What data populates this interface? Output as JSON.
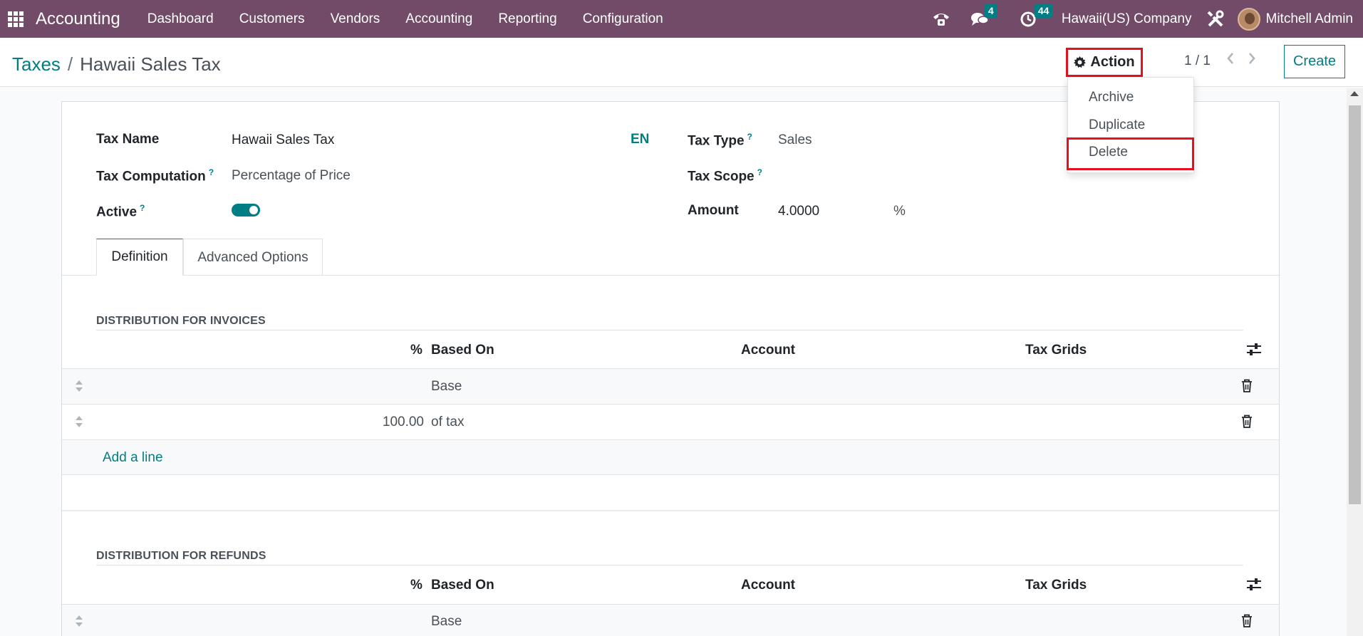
{
  "navbar": {
    "brand": "Accounting",
    "menu": [
      "Dashboard",
      "Customers",
      "Vendors",
      "Accounting",
      "Reporting",
      "Configuration"
    ],
    "messages_count": "4",
    "activities_count": "44",
    "company": "Hawaii(US) Company",
    "user": "Mitchell Admin"
  },
  "breadcrumb": {
    "parent": "Taxes",
    "separator": "/",
    "current": "Hawaii Sales Tax"
  },
  "toolbar": {
    "action_label": "Action",
    "pager": "1 / 1",
    "create_label": "Create"
  },
  "action_menu": {
    "items": [
      "Archive",
      "Duplicate",
      "Delete"
    ]
  },
  "form": {
    "tax_name_label": "Tax Name",
    "tax_name_value": "Hawaii Sales Tax",
    "lang": "EN",
    "tax_computation_label": "Tax Computation",
    "tax_computation_value": "Percentage of Price",
    "active_label": "Active",
    "active": true,
    "tax_type_label": "Tax Type",
    "tax_type_value": "Sales",
    "tax_scope_label": "Tax Scope",
    "tax_scope_value": "",
    "amount_label": "Amount",
    "amount_value": "4.0000",
    "amount_unit": "%",
    "help_mark": "?"
  },
  "tabs": [
    "Definition",
    "Advanced Options"
  ],
  "invoices": {
    "title": "DISTRIBUTION FOR INVOICES",
    "columns": [
      "%",
      "Based On",
      "Account",
      "Tax Grids"
    ],
    "rows": [
      {
        "percent": "",
        "based_on": "Base"
      },
      {
        "percent": "100.00",
        "based_on": "of tax"
      }
    ],
    "add_line": "Add a line"
  },
  "refunds": {
    "title": "DISTRIBUTION FOR REFUNDS",
    "columns": [
      "%",
      "Based On",
      "Account",
      "Tax Grids"
    ],
    "rows": [
      {
        "percent": "",
        "based_on": "Base"
      }
    ]
  },
  "colors": {
    "navbar": "#714b67",
    "accent": "#017e84",
    "highlight": "#e3101e"
  },
  "icons": [
    "apps-grid-icon",
    "phone-icon",
    "chat-icon",
    "clock-icon",
    "tools-icon",
    "gear-icon",
    "chevron-left-icon",
    "chevron-right-icon",
    "drag-handle-icon",
    "trash-icon",
    "column-settings-icon"
  ]
}
